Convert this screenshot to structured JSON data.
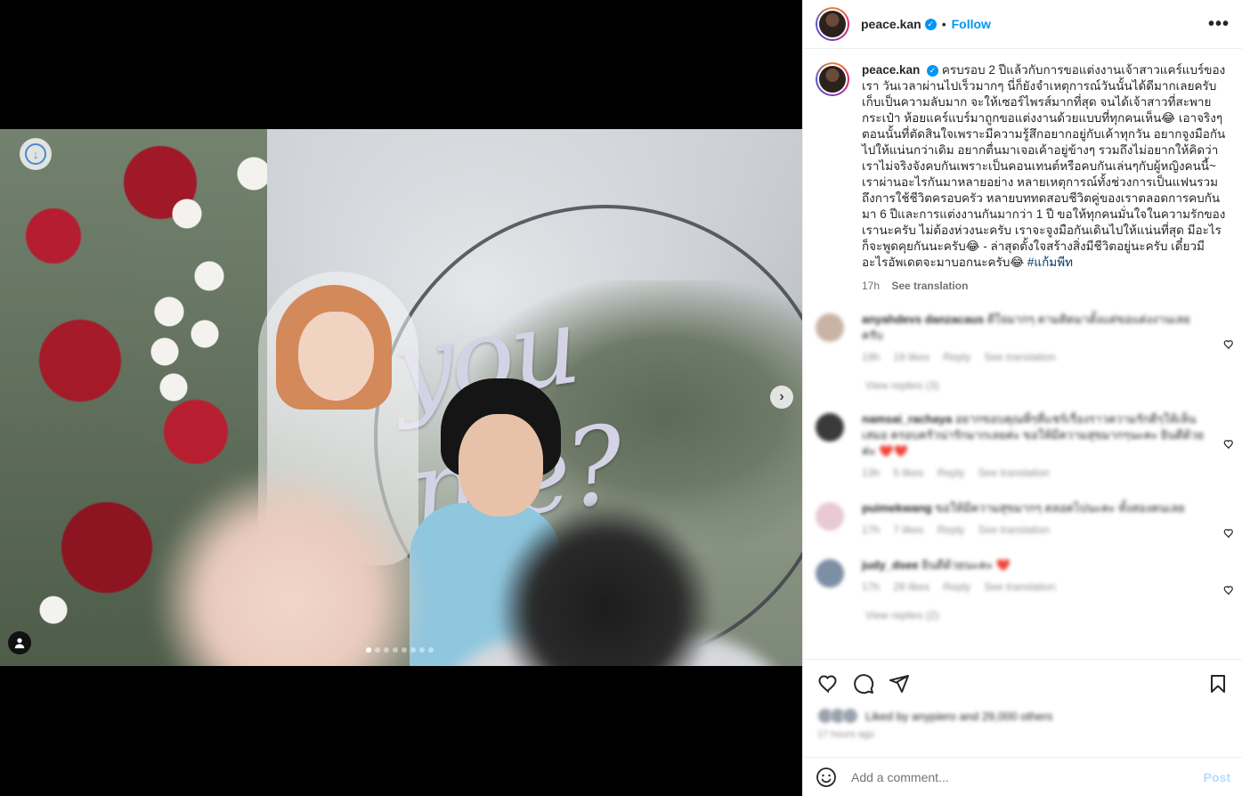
{
  "post": {
    "username": "peace.kan",
    "separator": "•",
    "follow_label": "Follow",
    "more_label": "•••",
    "caption": "ครบรอบ 2 ปีแล้วกับการขอแต่งงานเจ้าสาวแคร์แบร์ของเรา วันเวลาผ่านไปเร็วมากๆ นี่ก็ยังจำเหตุการณ์วันนั้นได้ดีมากเลยครับ เก็บเป็นความลับมาก จะให้เซอร์ไพรส์มากที่สุด จนได้เจ้าสาวที่สะพายกระเป๋า ห้อยแคร์แบร์มาถูกขอแต่งงานด้วยแบบที่ทุกคนเห็น😂 เอาจริงๆตอนนั้นที่ตัดสินใจเพราะมีความรู้สึกอยากอยู่กับเค้าทุกวัน อยากจูงมือกันไปให้แน่นกว่าเดิม อยากตื่นมาเจอเค้าอยู่ข้างๆ รวมถึงไม่อยากให้คิดว่าเราไม่จริงจังคบกันเพราะเป็นคอนเทนต์หรือคบกันเล่นๆกับผู้หญิงคนนี้~ เราผ่านอะไรกันมาหลายอย่าง หลายเหตุการณ์ทั้งช่วงการเป็นแฟนรวมถึงการใช้ชีวิตครอบครัว หลายบททดสอบชีวิตคู่ของเราตลอดการคบกันมา 6 ปีและการแต่งงานกันมากว่า 1 ปี ขอให้ทุกคนมั่นใจในความรักของเรานะครับ ไม่ต้องห่วงนะครับ เราจะจูงมือกันเดินไปให้แน่นที่สุด มีอะไรก็จะพูดคุยกันนะครับ😂 - ล่าสุดตั้งใจสร้างสิ่งมีชีวิตอยู่นะครับ เดี๋ยวมีอะไรอัพเดตจะมาบอกนะครับ😂",
    "hashtag": "#แก้มพีท",
    "time": "17h",
    "see_translation": "See translation",
    "photo_sign_text": "you me?"
  },
  "comments": [
    {
      "username": "anyahdevs danzacaus",
      "text": "ดีใจมากๆ ตามติดมาตั้งแต่ขอแต่งงานเลยครับ",
      "meta": [
        "19h",
        "19 likes",
        "Reply",
        "See translation"
      ],
      "view_replies": "View replies (3)",
      "avatar_color": "#c9b3a6"
    },
    {
      "username": "namsai_rachaya",
      "text": "อยากขอบคุณพี่ๆที่แชร์เรื่องราวความรักดีๆให้เห็นเสมอ ครอบครัวน่ารักมากเลยค่ะ ขอให้มีความสุขมากๆนะคะ ยินดีด้วยค่ะ ❤️❤️",
      "meta": [
        "13h",
        "5 likes",
        "Reply",
        "See translation"
      ],
      "view_replies": "",
      "avatar_color": "#3a3a3a"
    },
    {
      "username": "puimekwang",
      "text": "ขอให้มีความสุขมากๆ ตลอดไปนะคะ ทั้งสองคนเลย",
      "meta": [
        "17h",
        "7 likes",
        "Reply",
        "See translation"
      ],
      "view_replies": "",
      "avatar_color": "#e9c9d3"
    },
    {
      "username": "judy_dsee",
      "text": "ยินดีด้วยนะคะ ❤️",
      "meta": [
        "17h",
        "28 likes",
        "Reply",
        "See translation"
      ],
      "view_replies": "View replies (2)",
      "avatar_color": "#7d8fa5"
    }
  ],
  "actions": {
    "like_icon": "heart-icon",
    "comment_icon": "comment-icon",
    "share_icon": "send-icon",
    "save_icon": "bookmark-icon"
  },
  "likes": {
    "text": "Liked by anypiero and 29,000 others",
    "ago": "17 hours ago"
  },
  "add_comment": {
    "placeholder": "Add a comment...",
    "post_label": "Post"
  },
  "carousel": {
    "total": 8,
    "active_index": 0
  },
  "colors": {
    "accent": "#0095f6",
    "post_disabled": "#b3dbff"
  }
}
